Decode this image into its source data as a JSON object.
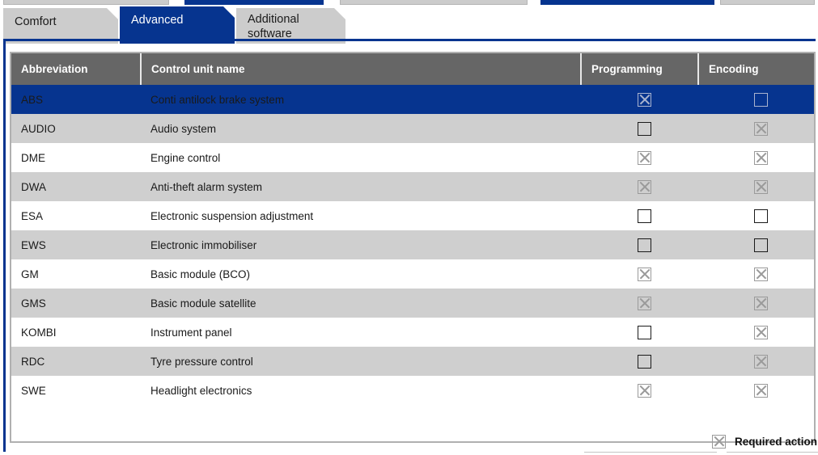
{
  "tabs": [
    {
      "label": "Comfort",
      "active": false
    },
    {
      "label": "Advanced",
      "active": true
    },
    {
      "label": "Additional\nsoftware",
      "active": false
    }
  ],
  "table": {
    "columns": [
      "Abbreviation",
      "Control unit name",
      "Programming",
      "Encoding"
    ],
    "rows": [
      {
        "abbreviation": "ABS",
        "name": "Conti antilock brake system",
        "programming": "checked",
        "encoding": "empty",
        "selected": true
      },
      {
        "abbreviation": "AUDIO",
        "name": "Audio system",
        "programming": "empty",
        "encoding": "checked",
        "selected": false
      },
      {
        "abbreviation": "DME",
        "name": "Engine control",
        "programming": "checked",
        "encoding": "checked",
        "selected": false
      },
      {
        "abbreviation": "DWA",
        "name": "Anti-theft alarm system",
        "programming": "checked",
        "encoding": "checked",
        "selected": false
      },
      {
        "abbreviation": "ESA",
        "name": "Electronic suspension adjustment",
        "programming": "empty",
        "encoding": "empty",
        "selected": false
      },
      {
        "abbreviation": "EWS",
        "name": "Electronic immobiliser",
        "programming": "empty",
        "encoding": "empty",
        "selected": false
      },
      {
        "abbreviation": "GM",
        "name": "Basic module (BCO)",
        "programming": "checked",
        "encoding": "checked",
        "selected": false
      },
      {
        "abbreviation": "GMS",
        "name": "Basic module satellite",
        "programming": "checked",
        "encoding": "checked",
        "selected": false
      },
      {
        "abbreviation": "KOMBI",
        "name": "Instrument panel",
        "programming": "empty",
        "encoding": "checked",
        "selected": false
      },
      {
        "abbreviation": "RDC",
        "name": "Tyre pressure control",
        "programming": "empty",
        "encoding": "checked",
        "selected": false
      },
      {
        "abbreviation": "SWE",
        "name": "Headlight electronics",
        "programming": "checked",
        "encoding": "checked",
        "selected": false
      }
    ]
  },
  "legend": {
    "icon": "checked-box-icon",
    "label": "Required action"
  },
  "colors": {
    "accent_blue": "#06348f",
    "header_gray": "#666666",
    "row_alt_gray": "#cfcfcf",
    "tab_gray": "#cccccc",
    "checkbox_disabled": "#9a9a9a"
  }
}
